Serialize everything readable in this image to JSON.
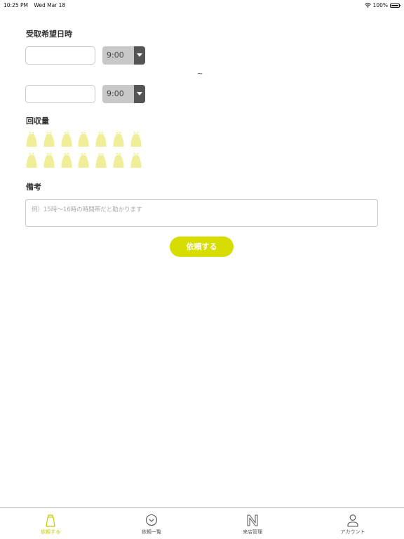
{
  "status_bar": {
    "time": "10:25 PM",
    "date": "Wed Mar 18",
    "battery": "100%"
  },
  "pickup": {
    "title": "受取希望日時",
    "start": {
      "date_value": "",
      "time_value": "9:00"
    },
    "separator": "~",
    "end": {
      "date_value": "",
      "time_value": "9:00"
    }
  },
  "quantity": {
    "title": "回収量",
    "max_bags": 14,
    "selected": 0,
    "bag_color": "#f1ee9a"
  },
  "memo": {
    "title": "備考",
    "value": "",
    "placeholder": "例）15時〜16時の時間帯だと助かります"
  },
  "submit": {
    "label": "依頼する",
    "color": "#d7dd00"
  },
  "tab_bar": {
    "active_color": "#c9cc00",
    "items": [
      {
        "label": "依頼する",
        "icon": "bag-icon",
        "active": true
      },
      {
        "label": "依頼一覧",
        "icon": "chevron-circle-icon",
        "active": false
      },
      {
        "label": "来店管理",
        "icon": "n-logo-icon",
        "active": false
      },
      {
        "label": "アカウント",
        "icon": "person-icon",
        "active": false
      }
    ]
  }
}
